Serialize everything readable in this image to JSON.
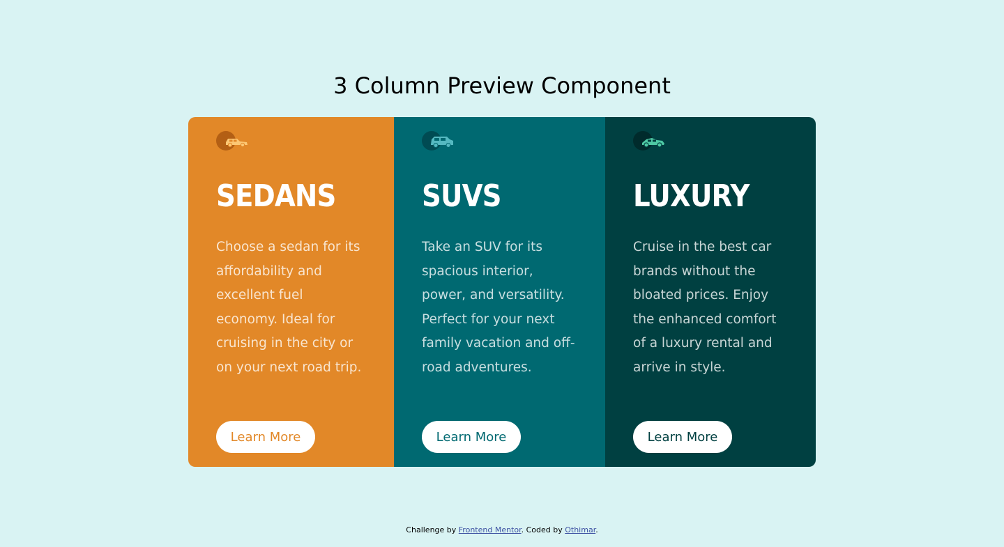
{
  "page": {
    "title": "3 Column Preview Component"
  },
  "cards": [
    {
      "id": "sedans",
      "icon": "sedan-car-icon",
      "title": "SEDANS",
      "text": "Choose a sedan for its affordability and excellent fuel economy. Ideal for cruising in the city or on your next road trip.",
      "button": "Learn More",
      "color": "#e28828"
    },
    {
      "id": "suvs",
      "icon": "suv-car-icon",
      "title": "SUVS",
      "text": "Take an SUV for its spacious interior, power, and versatility. Perfect for your next family vacation and off-road adventures.",
      "button": "Learn More",
      "color": "#006971"
    },
    {
      "id": "luxury",
      "icon": "luxury-car-icon",
      "title": "LUXURY",
      "text": "Cruise in the best car brands without the bloated prices. Enjoy the enhanced comfort of a luxury rental and arrive in style.",
      "button": "Learn More",
      "color": "#004041"
    }
  ],
  "footer": {
    "prefix": "Challenge by ",
    "challenge_link": "Frontend Mentor",
    "middle": ". Coded by ",
    "author_link": "Othimar",
    "suffix": "."
  },
  "colors": {
    "background": "#d9f3f3",
    "sedans": "#e28828",
    "suvs": "#006971",
    "luxury": "#004041",
    "link": "#3e52a3"
  }
}
